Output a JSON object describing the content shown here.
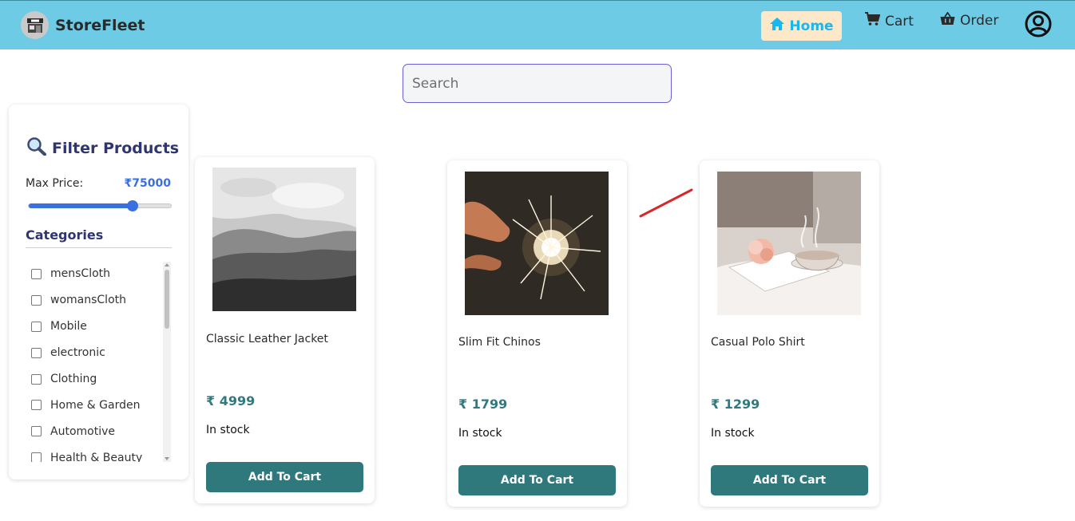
{
  "app": {
    "brand_name": "StoreFleet"
  },
  "nav": {
    "home_label": "Home",
    "cart_label": "Cart",
    "order_label": "Order"
  },
  "search": {
    "placeholder": "Search"
  },
  "filter": {
    "title": "Filter Products",
    "max_price_label": "Max Price:",
    "max_price_value": "₹75000",
    "slider_fraction": 0.73,
    "categories_title": "Categories",
    "categories": [
      "mensCloth",
      "womansCloth",
      "Mobile",
      "electronic",
      "Clothing",
      "Home & Garden",
      "Automotive",
      "Health & Beauty"
    ]
  },
  "products": [
    {
      "name": "Classic Leather Jacket",
      "price": "₹ 4999",
      "stock": "In stock",
      "button": "Add To Cart"
    },
    {
      "name": "Slim Fit Chinos",
      "price": "₹ 1799",
      "stock": "In stock",
      "button": "Add To Cart"
    },
    {
      "name": "Casual Polo Shirt",
      "price": "₹ 1299",
      "stock": "In stock",
      "button": "Add To Cart"
    }
  ],
  "colors": {
    "navbar": "#6dcbe6",
    "home_bg": "#fde9c9",
    "accent_blue": "#3a6fe0",
    "button_teal": "#2f787b",
    "heading": "#2f3570"
  }
}
